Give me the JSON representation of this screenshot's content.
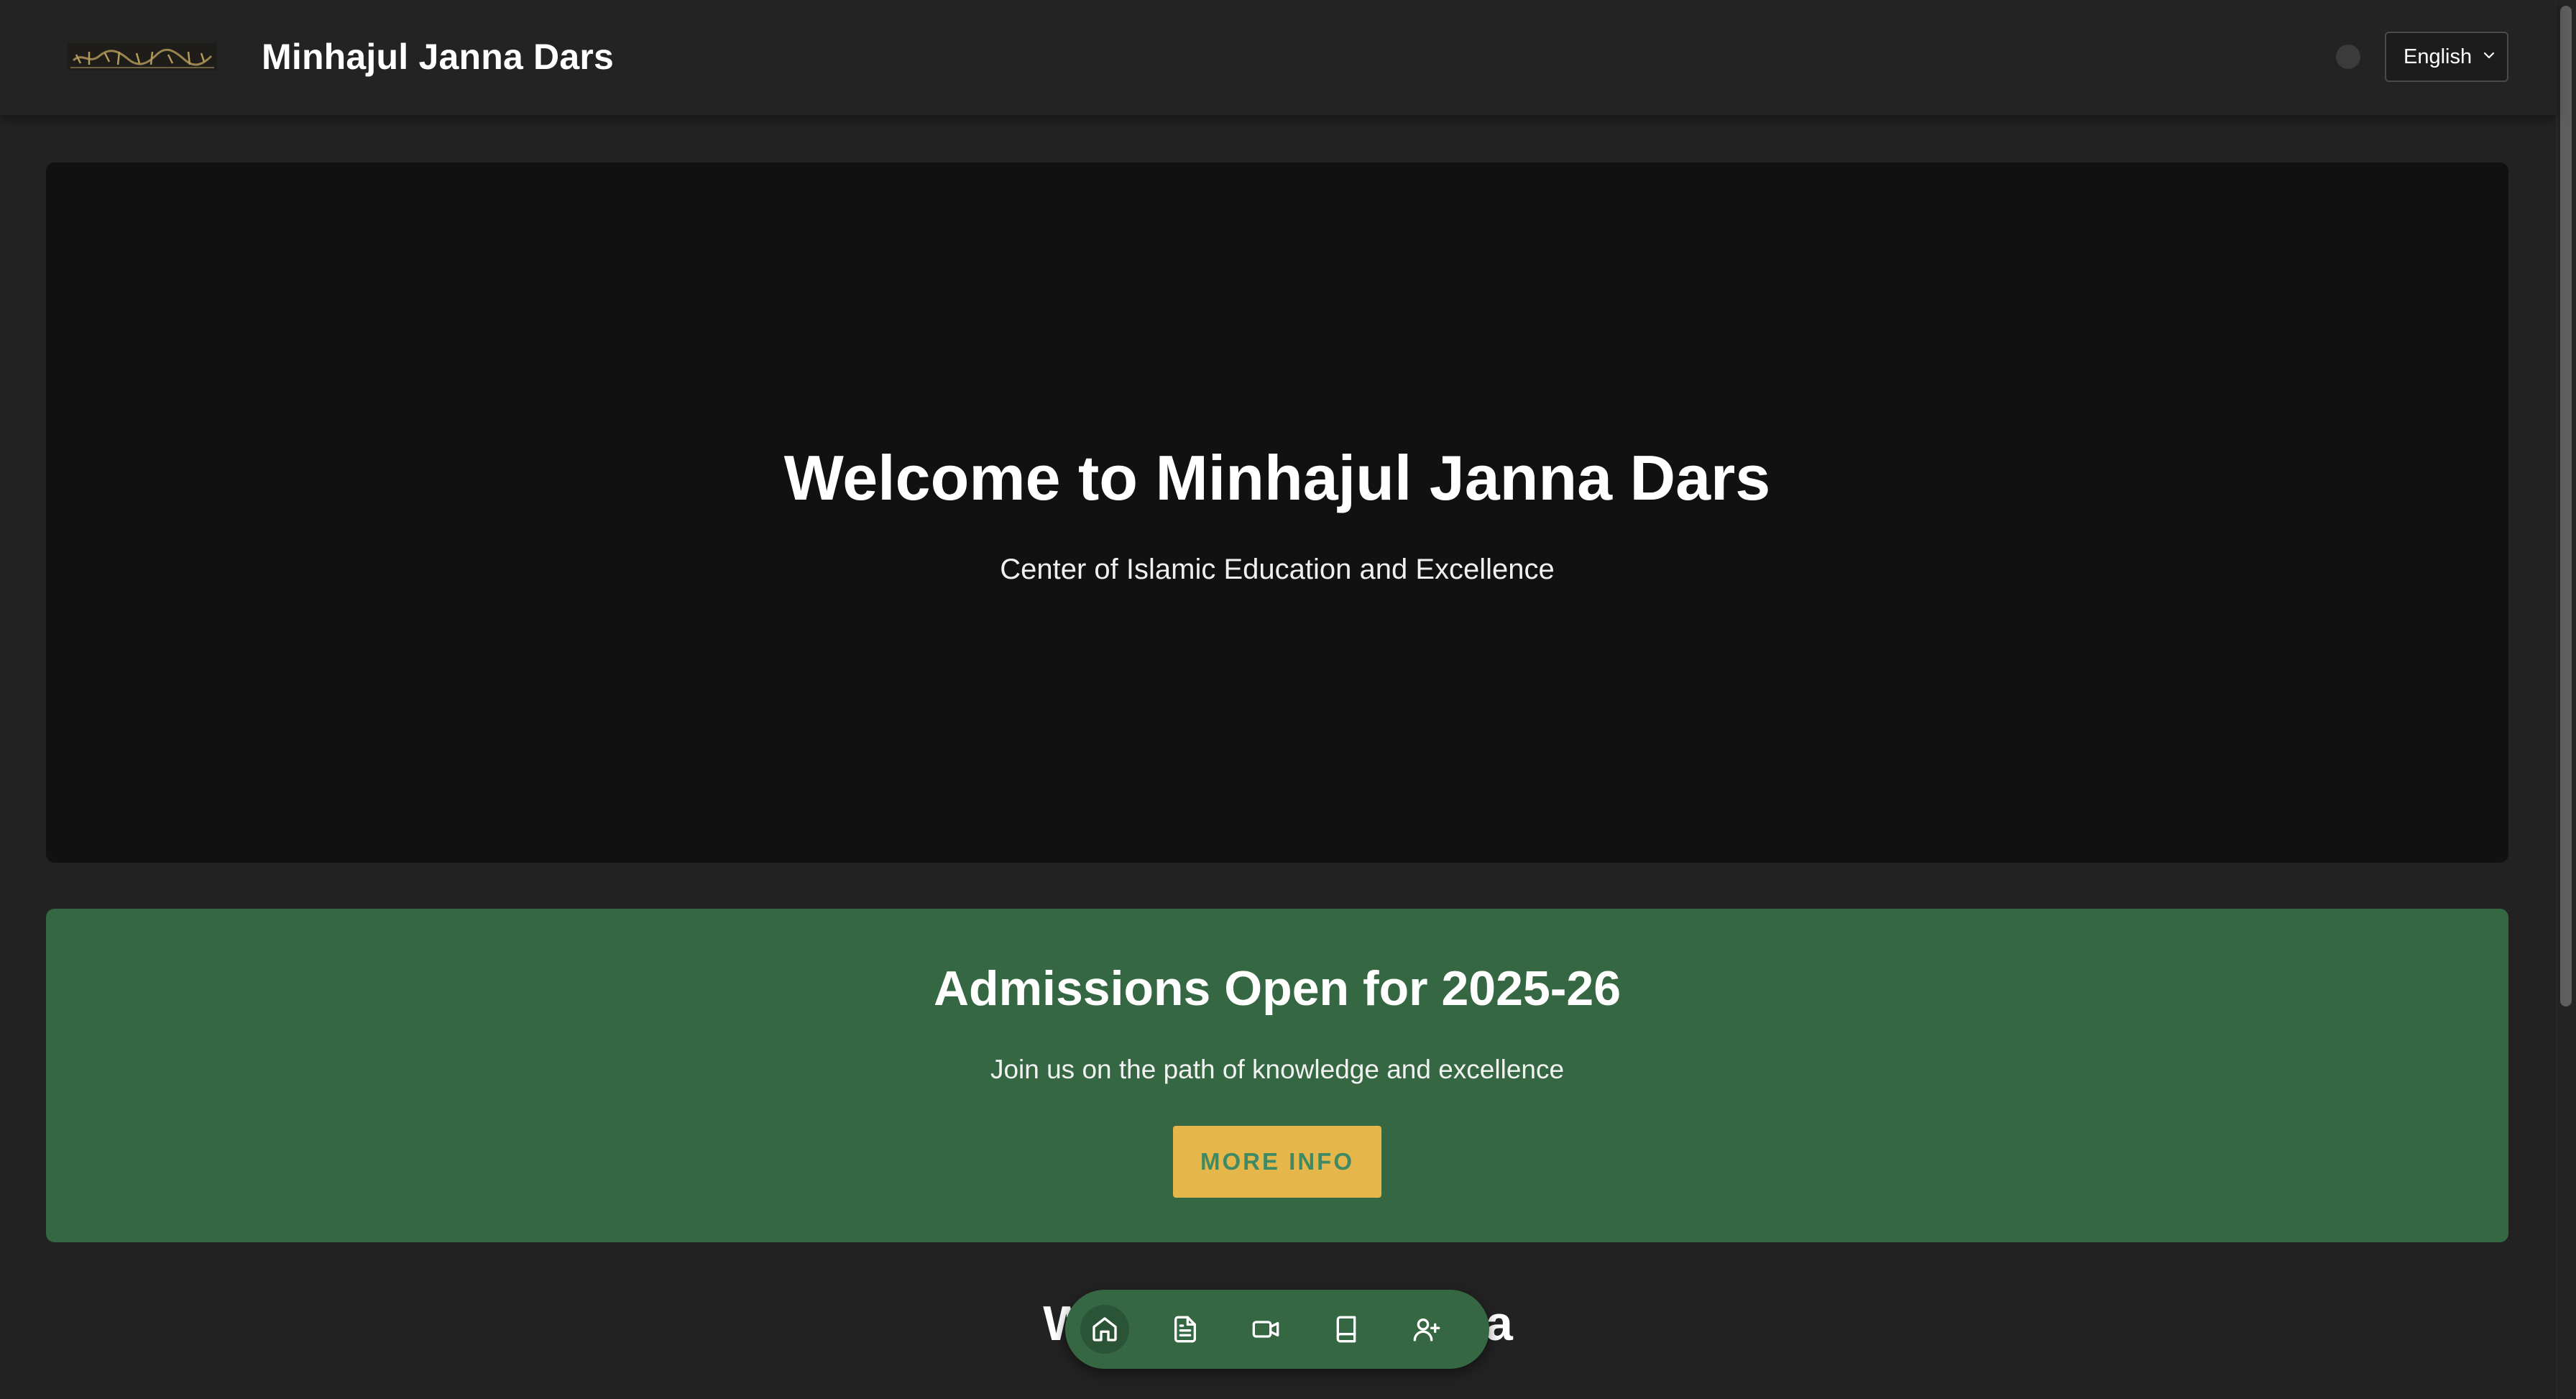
{
  "header": {
    "site_title": "Minhajul Janna Dars",
    "logo_icon": "arabic-calligraphy-logo",
    "theme_toggle_icon": "theme-toggle-icon",
    "language": {
      "selected": "English"
    }
  },
  "hero": {
    "title": "Welcome to Minhajul Janna Dars",
    "subtitle": "Center of Islamic Education and Excellence"
  },
  "admissions": {
    "title": "Admissions Open for 2025-26",
    "subtitle": "Join us on the path of knowledge and excellence",
    "button_label": "MORE INFO"
  },
  "why_section": {
    "title_visible": "Why Minhajul Janna"
  },
  "bottom_nav": {
    "items": [
      {
        "icon": "home-icon",
        "active": true
      },
      {
        "icon": "document-icon",
        "active": false
      },
      {
        "icon": "video-icon",
        "active": false
      },
      {
        "icon": "book-icon",
        "active": false
      },
      {
        "icon": "user-plus-icon",
        "active": false
      }
    ]
  },
  "colors": {
    "page_background": "#222222",
    "header_background": "#232323",
    "hero_background": "#111111",
    "accent_green": "#356842",
    "button_gold": "#e5b64a",
    "button_text": "#3f8a64"
  }
}
